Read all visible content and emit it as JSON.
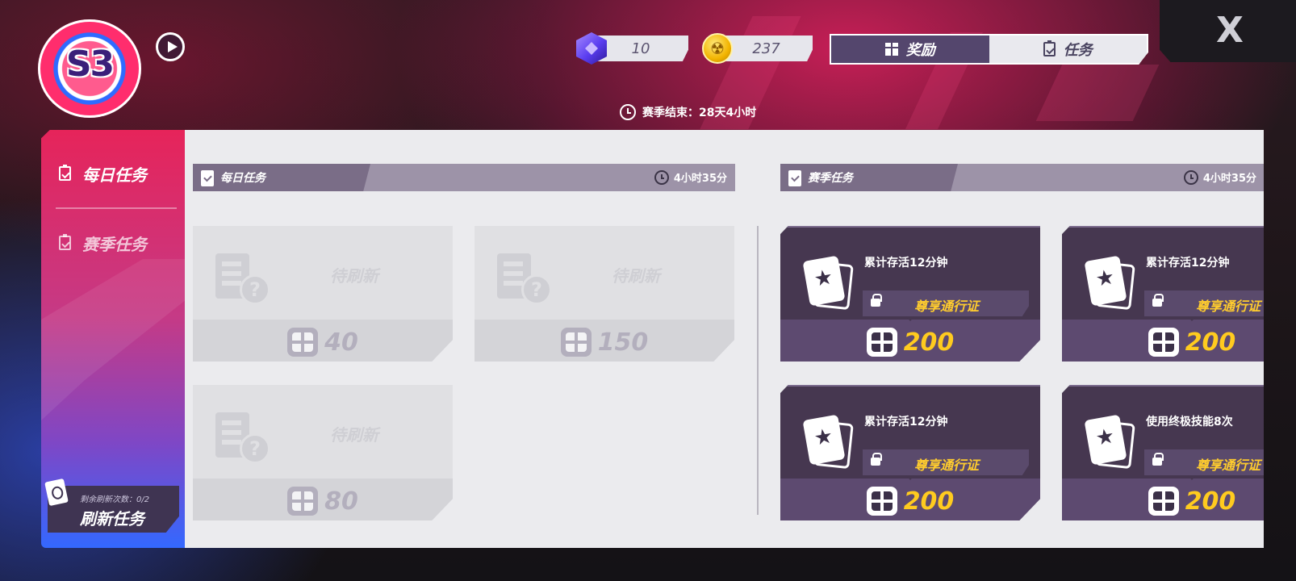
{
  "season": {
    "badge_text": "S3",
    "ends_label": "赛季结束：28天4小时"
  },
  "currencies": [
    {
      "icon": "purple-gem-icon",
      "value": "10"
    },
    {
      "icon": "gold-coin-icon",
      "value": "237"
    }
  ],
  "top_tabs": [
    {
      "label": "奖励",
      "icon": "gift-icon",
      "active": true
    },
    {
      "label": "任务",
      "icon": "clipboard-check-icon",
      "active": false
    }
  ],
  "close_label": "X",
  "sidebar": {
    "items": [
      {
        "label": "每日任务",
        "active": true
      },
      {
        "label": "赛季任务",
        "active": false
      }
    ],
    "refresh": {
      "count_label": "剩余刷新次数：0/2",
      "button_label": "刷新任务"
    }
  },
  "daily": {
    "title": "每日任务",
    "timer": "4小时35分",
    "cards": [
      {
        "status": "待刷新",
        "reward": "40"
      },
      {
        "status": "待刷新",
        "reward": "150"
      },
      {
        "status": "待刷新",
        "reward": "80"
      }
    ]
  },
  "season_tasks": {
    "title": "赛季任务",
    "timer": "4小时35分",
    "cards": [
      {
        "desc": "累计存活12分钟",
        "lock_label": "尊享通行证",
        "reward": "200"
      },
      {
        "desc": "累计存活12分钟",
        "lock_label": "尊享通行证",
        "reward": "200"
      },
      {
        "desc": "累计存活12分钟",
        "lock_label": "尊享通行证",
        "reward": "200"
      },
      {
        "desc": "使用终极技能8次",
        "lock_label": "尊享通行证",
        "reward": "200"
      }
    ]
  },
  "colors": {
    "accent_pink": "#e6245a",
    "panel_purple": "#463750",
    "reward_gold": "#ffcb1f"
  }
}
